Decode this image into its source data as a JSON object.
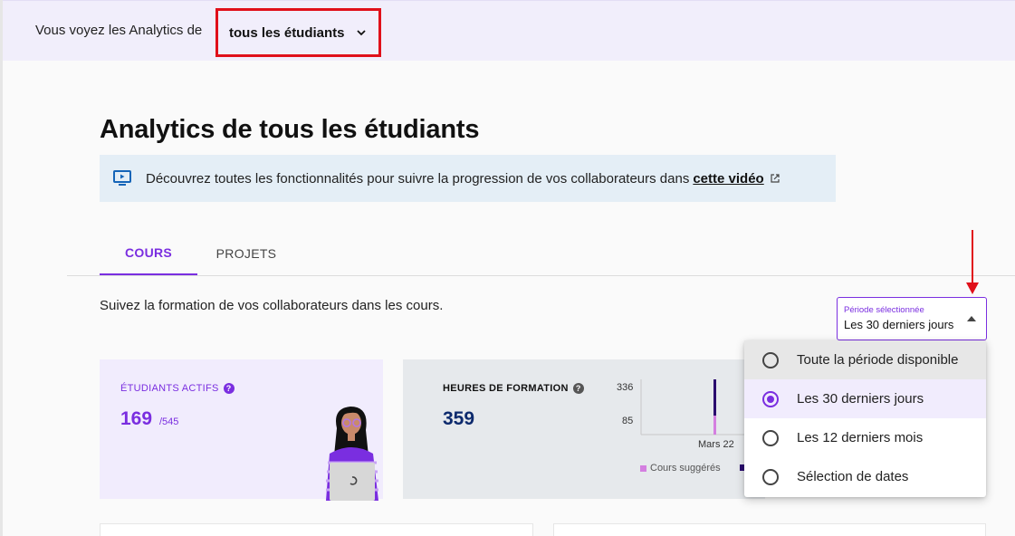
{
  "topbar": {
    "prefix": "Vous voyez les Analytics de",
    "scope_value": "tous les étudiants"
  },
  "page": {
    "title": "Analytics de tous les étudiants"
  },
  "banner": {
    "text": "Découvrez toutes les fonctionnalités pour suivre la progression de vos collaborateurs dans",
    "link": "cette vidéo"
  },
  "tabs": [
    {
      "label": "COURS",
      "active": true
    },
    {
      "label": "PROJETS",
      "active": false
    }
  ],
  "subtitle": "Suivez la formation de vos collaborateurs dans les cours.",
  "period": {
    "label": "Période sélectionnée",
    "value": "Les 30 derniers jours",
    "options": [
      {
        "label": "Toute la période disponible",
        "state": "hover"
      },
      {
        "label": "Les 30 derniers jours",
        "state": "selected"
      },
      {
        "label": "Les 12 derniers mois",
        "state": ""
      },
      {
        "label": "Sélection de dates",
        "state": ""
      }
    ]
  },
  "cards": {
    "students": {
      "heading": "ÉTUDIANTS ACTIFS",
      "value": "169",
      "total": "/545"
    },
    "hours": {
      "heading": "HEURES DE FORMATION",
      "value": "359"
    }
  },
  "chart_data": {
    "type": "bar",
    "categories": [
      "Mars 22"
    ],
    "yticks": [
      "336",
      "85"
    ],
    "series": [
      {
        "name": "Cours suggérés",
        "color": "#d47fe0"
      },
      {
        "name": "",
        "color": "#2a0a6e"
      }
    ]
  },
  "colors": {
    "accent": "#7a2ee0",
    "highlight_box": "#e0101a",
    "banner_bg": "#e4eef6",
    "topbar_bg": "#f1eefb"
  }
}
